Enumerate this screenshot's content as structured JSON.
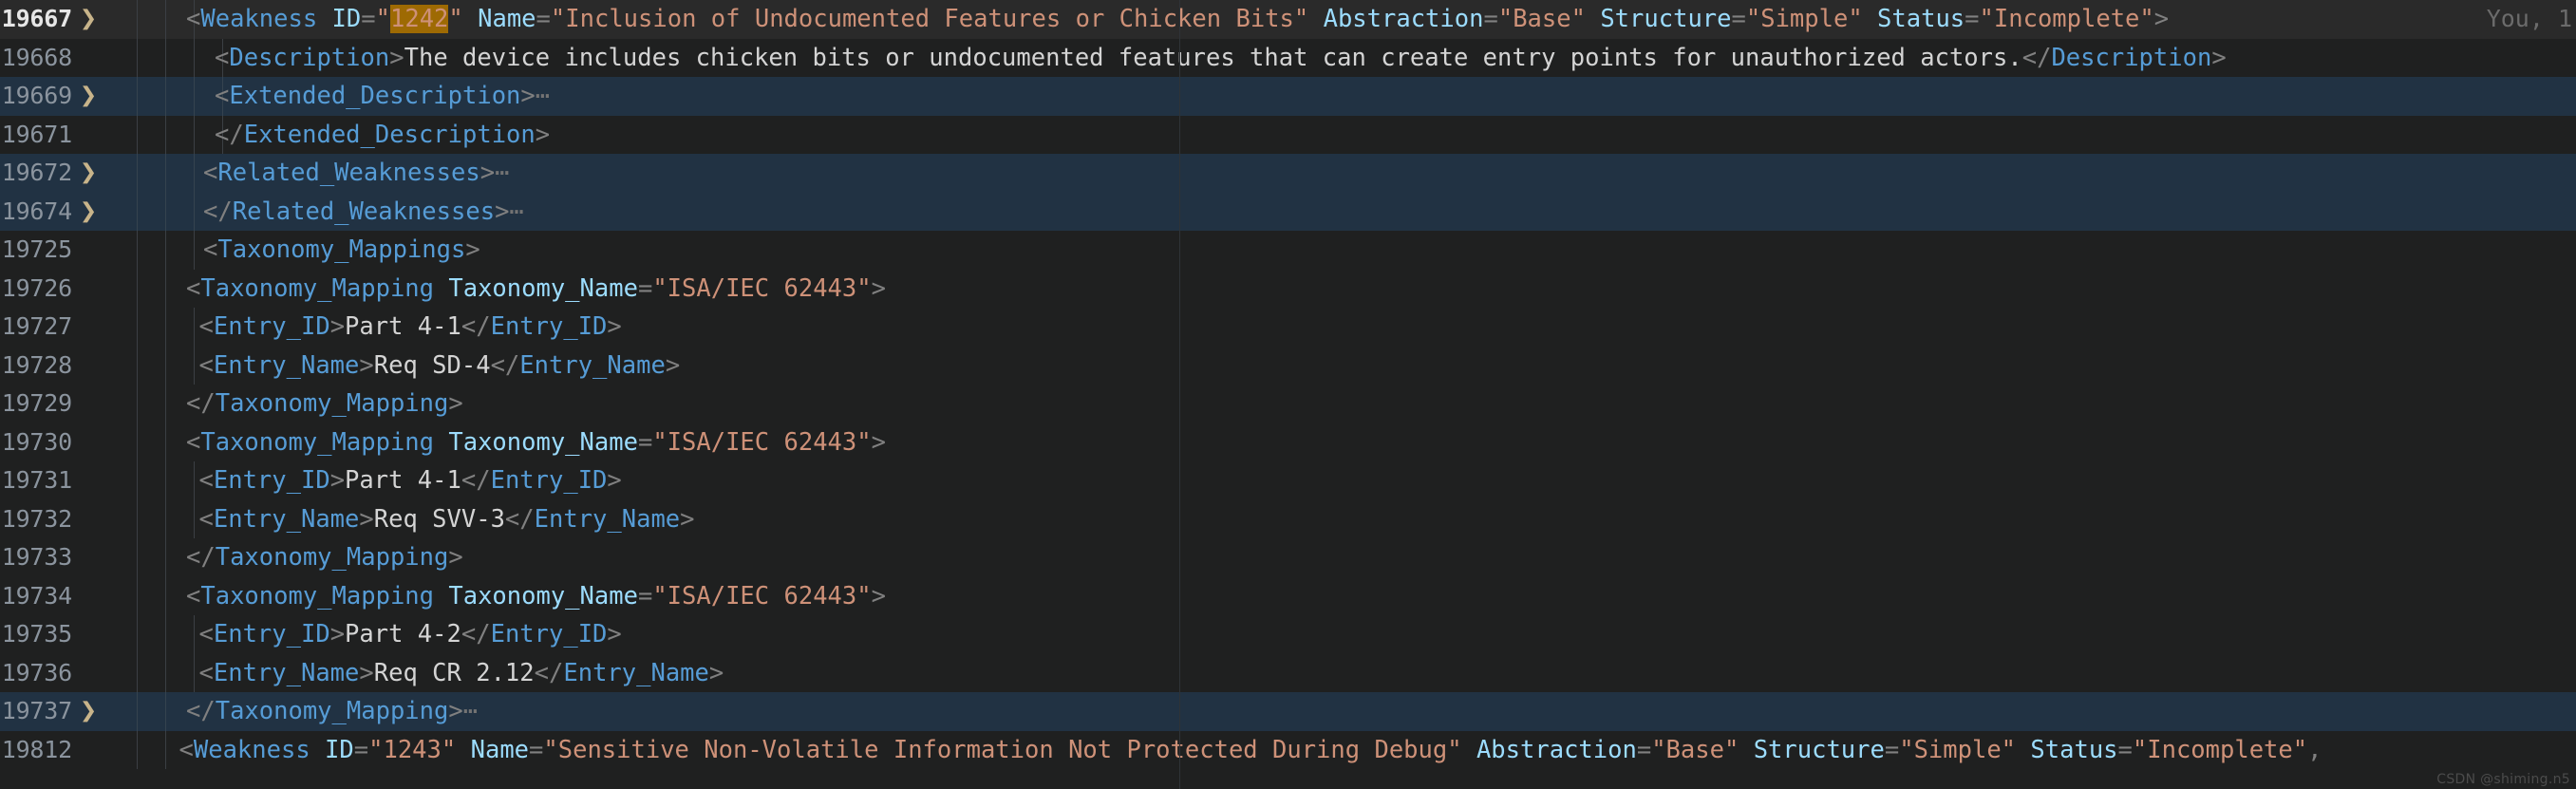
{
  "editor": {
    "theme": "dark-plus",
    "colors": {
      "background": "#1f2020",
      "current_line": "#2a2a2a",
      "selection": "#213243",
      "tag": "#569cd6",
      "attribute": "#9cdcfe",
      "string": "#ce9178",
      "text": "#d4d4d4",
      "punctuation": "#808080",
      "line_number": "#8b949e",
      "find_match_highlight": "#9e6a03",
      "indent_guide": "#3b3f44"
    },
    "blame_annotation": "You, 1",
    "fold_chevron": "❯",
    "folded_ellipsis": "⋯",
    "watermark": "CSDN @shiming.n5"
  },
  "lines": [
    {
      "number": "19667",
      "fold": true,
      "state": "current",
      "indent_guides": 3,
      "indent": 1,
      "blame": "You, 1",
      "tokens": [
        {
          "t": "<",
          "c": "pn"
        },
        {
          "t": "Weakness",
          "c": "tag"
        },
        {
          "t": " ",
          "c": "pn"
        },
        {
          "t": "ID",
          "c": "attr"
        },
        {
          "t": "=",
          "c": "pn"
        },
        {
          "t": "\"",
          "c": "str"
        },
        {
          "t": "1242",
          "c": "hl"
        },
        {
          "t": "\"",
          "c": "str"
        },
        {
          "t": " ",
          "c": "pn"
        },
        {
          "t": "Name",
          "c": "attr"
        },
        {
          "t": "=",
          "c": "pn"
        },
        {
          "t": "\"Inclusion of Undocumented Features or Chicken Bits\"",
          "c": "str"
        },
        {
          "t": " ",
          "c": "pn"
        },
        {
          "t": "Abstraction",
          "c": "attr"
        },
        {
          "t": "=",
          "c": "pn"
        },
        {
          "t": "\"Base\"",
          "c": "str"
        },
        {
          "t": " ",
          "c": "pn"
        },
        {
          "t": "Structure",
          "c": "attr"
        },
        {
          "t": "=",
          "c": "pn"
        },
        {
          "t": "\"Simple\"",
          "c": "str"
        },
        {
          "t": " ",
          "c": "pn"
        },
        {
          "t": "Status",
          "c": "attr"
        },
        {
          "t": "=",
          "c": "pn"
        },
        {
          "t": "\"Incomplete\"",
          "c": "str"
        },
        {
          "t": ">",
          "c": "pn"
        }
      ]
    },
    {
      "number": "19668",
      "fold": false,
      "state": "normal",
      "indent_guides": 4,
      "indent": 2,
      "tokens": [
        {
          "t": "<",
          "c": "pn"
        },
        {
          "t": "Description",
          "c": "tag"
        },
        {
          "t": ">",
          "c": "pn"
        },
        {
          "t": "The device includes chicken bits or undocumented features that can create entry points for unauthorized actors.",
          "c": "txtc"
        },
        {
          "t": "</",
          "c": "pn"
        },
        {
          "t": "Description",
          "c": "tag"
        },
        {
          "t": ">",
          "c": "pn"
        }
      ]
    },
    {
      "number": "19669",
      "fold": true,
      "state": "selected",
      "indent_guides": 4,
      "indent": 2,
      "tokens": [
        {
          "t": "<",
          "c": "pn"
        },
        {
          "t": "Extended_Description",
          "c": "tag"
        },
        {
          "t": ">",
          "c": "pn"
        },
        {
          "t": "⋯",
          "c": "dots"
        }
      ]
    },
    {
      "number": "19671",
      "fold": false,
      "state": "normal",
      "indent_guides": 4,
      "indent": 2,
      "tokens": [
        {
          "t": "</",
          "c": "pn"
        },
        {
          "t": "Extended_Description",
          "c": "tag"
        },
        {
          "t": ">",
          "c": "pn"
        }
      ]
    },
    {
      "number": "19672",
      "fold": true,
      "state": "selected",
      "indent_guides": 3,
      "indent": 1.6,
      "tokens": [
        {
          "t": "<",
          "c": "pn"
        },
        {
          "t": "Related_Weaknesses",
          "c": "tag"
        },
        {
          "t": ">",
          "c": "pn"
        },
        {
          "t": "⋯",
          "c": "dots"
        }
      ]
    },
    {
      "number": "19674",
      "fold": true,
      "state": "selected",
      "indent_guides": 3,
      "indent": 1.6,
      "tokens": [
        {
          "t": "</",
          "c": "pn"
        },
        {
          "t": "Related_Weaknesses",
          "c": "tag"
        },
        {
          "t": ">",
          "c": "pn"
        },
        {
          "t": "⋯",
          "c": "dots"
        }
      ]
    },
    {
      "number": "19725",
      "fold": false,
      "state": "normal",
      "indent_guides": 3,
      "indent": 1.6,
      "tokens": [
        {
          "t": "<",
          "c": "pn"
        },
        {
          "t": "Taxonomy_Mappings",
          "c": "tag"
        },
        {
          "t": ">",
          "c": "pn"
        }
      ]
    },
    {
      "number": "19726",
      "fold": false,
      "state": "normal",
      "indent_guides": 2,
      "indent": 1,
      "tokens": [
        {
          "t": "<",
          "c": "pn"
        },
        {
          "t": "Taxonomy_Mapping",
          "c": "tag"
        },
        {
          "t": " ",
          "c": "pn"
        },
        {
          "t": "Taxonomy_Name",
          "c": "attr"
        },
        {
          "t": "=",
          "c": "pn"
        },
        {
          "t": "\"ISA/IEC 62443\"",
          "c": "str"
        },
        {
          "t": ">",
          "c": "pn"
        }
      ]
    },
    {
      "number": "19727",
      "fold": false,
      "state": "normal",
      "indent_guides": 3,
      "indent": 1.45,
      "tokens": [
        {
          "t": "<",
          "c": "pn"
        },
        {
          "t": "Entry_ID",
          "c": "tag"
        },
        {
          "t": ">",
          "c": "pn"
        },
        {
          "t": "Part 4-1",
          "c": "txtc"
        },
        {
          "t": "</",
          "c": "pn"
        },
        {
          "t": "Entry_ID",
          "c": "tag"
        },
        {
          "t": ">",
          "c": "pn"
        }
      ]
    },
    {
      "number": "19728",
      "fold": false,
      "state": "normal",
      "indent_guides": 3,
      "indent": 1.45,
      "tokens": [
        {
          "t": "<",
          "c": "pn"
        },
        {
          "t": "Entry_Name",
          "c": "tag"
        },
        {
          "t": ">",
          "c": "pn"
        },
        {
          "t": "Req SD-4",
          "c": "txtc"
        },
        {
          "t": "</",
          "c": "pn"
        },
        {
          "t": "Entry_Name",
          "c": "tag"
        },
        {
          "t": ">",
          "c": "pn"
        }
      ]
    },
    {
      "number": "19729",
      "fold": false,
      "state": "normal",
      "indent_guides": 2,
      "indent": 1,
      "tokens": [
        {
          "t": "</",
          "c": "pn"
        },
        {
          "t": "Taxonomy_Mapping",
          "c": "tag"
        },
        {
          "t": ">",
          "c": "pn"
        }
      ]
    },
    {
      "number": "19730",
      "fold": false,
      "state": "normal",
      "indent_guides": 2,
      "indent": 1,
      "tokens": [
        {
          "t": "<",
          "c": "pn"
        },
        {
          "t": "Taxonomy_Mapping",
          "c": "tag"
        },
        {
          "t": " ",
          "c": "pn"
        },
        {
          "t": "Taxonomy_Name",
          "c": "attr"
        },
        {
          "t": "=",
          "c": "pn"
        },
        {
          "t": "\"ISA/IEC 62443\"",
          "c": "str"
        },
        {
          "t": ">",
          "c": "pn"
        }
      ]
    },
    {
      "number": "19731",
      "fold": false,
      "state": "normal",
      "indent_guides": 3,
      "indent": 1.45,
      "tokens": [
        {
          "t": "<",
          "c": "pn"
        },
        {
          "t": "Entry_ID",
          "c": "tag"
        },
        {
          "t": ">",
          "c": "pn"
        },
        {
          "t": "Part 4-1",
          "c": "txtc"
        },
        {
          "t": "</",
          "c": "pn"
        },
        {
          "t": "Entry_ID",
          "c": "tag"
        },
        {
          "t": ">",
          "c": "pn"
        }
      ]
    },
    {
      "number": "19732",
      "fold": false,
      "state": "normal",
      "indent_guides": 3,
      "indent": 1.45,
      "tokens": [
        {
          "t": "<",
          "c": "pn"
        },
        {
          "t": "Entry_Name",
          "c": "tag"
        },
        {
          "t": ">",
          "c": "pn"
        },
        {
          "t": "Req SVV-3",
          "c": "txtc"
        },
        {
          "t": "</",
          "c": "pn"
        },
        {
          "t": "Entry_Name",
          "c": "tag"
        },
        {
          "t": ">",
          "c": "pn"
        }
      ]
    },
    {
      "number": "19733",
      "fold": false,
      "state": "normal",
      "indent_guides": 2,
      "indent": 1,
      "tokens": [
        {
          "t": "</",
          "c": "pn"
        },
        {
          "t": "Taxonomy_Mapping",
          "c": "tag"
        },
        {
          "t": ">",
          "c": "pn"
        }
      ]
    },
    {
      "number": "19734",
      "fold": false,
      "state": "normal",
      "indent_guides": 2,
      "indent": 1,
      "tokens": [
        {
          "t": "<",
          "c": "pn"
        },
        {
          "t": "Taxonomy_Mapping",
          "c": "tag"
        },
        {
          "t": " ",
          "c": "pn"
        },
        {
          "t": "Taxonomy_Name",
          "c": "attr"
        },
        {
          "t": "=",
          "c": "pn"
        },
        {
          "t": "\"ISA/IEC 62443\"",
          "c": "str"
        },
        {
          "t": ">",
          "c": "pn"
        }
      ]
    },
    {
      "number": "19735",
      "fold": false,
      "state": "normal",
      "indent_guides": 3,
      "indent": 1.45,
      "tokens": [
        {
          "t": "<",
          "c": "pn"
        },
        {
          "t": "Entry_ID",
          "c": "tag"
        },
        {
          "t": ">",
          "c": "pn"
        },
        {
          "t": "Part 4-2",
          "c": "txtc"
        },
        {
          "t": "</",
          "c": "pn"
        },
        {
          "t": "Entry_ID",
          "c": "tag"
        },
        {
          "t": ">",
          "c": "pn"
        }
      ]
    },
    {
      "number": "19736",
      "fold": false,
      "state": "normal",
      "indent_guides": 3,
      "indent": 1.45,
      "tokens": [
        {
          "t": "<",
          "c": "pn"
        },
        {
          "t": "Entry_Name",
          "c": "tag"
        },
        {
          "t": ">",
          "c": "pn"
        },
        {
          "t": "Req CR 2.12",
          "c": "txtc"
        },
        {
          "t": "</",
          "c": "pn"
        },
        {
          "t": "Entry_Name",
          "c": "tag"
        },
        {
          "t": ">",
          "c": "pn"
        }
      ]
    },
    {
      "number": "19737",
      "fold": true,
      "state": "selected",
      "indent_guides": 2,
      "indent": 1,
      "tokens": [
        {
          "t": "</",
          "c": "pn"
        },
        {
          "t": "Taxonomy_Mapping",
          "c": "tag"
        },
        {
          "t": ">",
          "c": "pn"
        },
        {
          "t": "⋯",
          "c": "dots"
        }
      ]
    },
    {
      "number": "19812",
      "fold": false,
      "state": "normal",
      "indent_guides": 2,
      "indent": 0.75,
      "tokens": [
        {
          "t": "<",
          "c": "pn"
        },
        {
          "t": "Weakness",
          "c": "tag"
        },
        {
          "t": " ",
          "c": "pn"
        },
        {
          "t": "ID",
          "c": "attr"
        },
        {
          "t": "=",
          "c": "pn"
        },
        {
          "t": "\"1243\"",
          "c": "str"
        },
        {
          "t": " ",
          "c": "pn"
        },
        {
          "t": "Name",
          "c": "attr"
        },
        {
          "t": "=",
          "c": "pn"
        },
        {
          "t": "\"Sensitive Non-Volatile Information Not Protected During Debug\"",
          "c": "str"
        },
        {
          "t": " ",
          "c": "pn"
        },
        {
          "t": "Abstraction",
          "c": "attr"
        },
        {
          "t": "=",
          "c": "pn"
        },
        {
          "t": "\"Base\"",
          "c": "str"
        },
        {
          "t": " ",
          "c": "pn"
        },
        {
          "t": "Structure",
          "c": "attr"
        },
        {
          "t": "=",
          "c": "pn"
        },
        {
          "t": "\"Simple\"",
          "c": "str"
        },
        {
          "t": " ",
          "c": "pn"
        },
        {
          "t": "Status",
          "c": "attr"
        },
        {
          "t": "=",
          "c": "pn"
        },
        {
          "t": "\"Incomplete\"",
          "c": "str"
        },
        {
          "t": ",",
          "c": "pn"
        }
      ]
    }
  ]
}
